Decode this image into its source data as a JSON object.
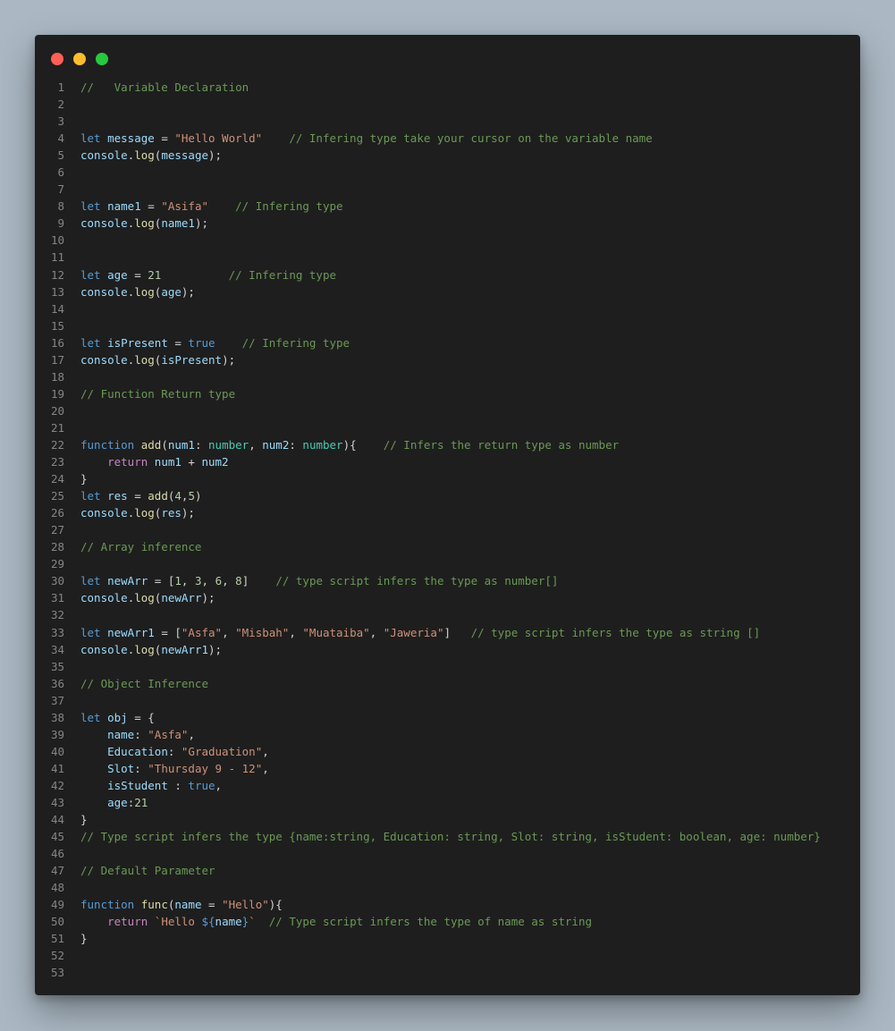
{
  "window": {
    "controls": [
      {
        "name": "close",
        "color": "#ff5f56"
      },
      {
        "name": "minimize",
        "color": "#ffbd2e"
      },
      {
        "name": "maximize",
        "color": "#27c93f"
      }
    ]
  },
  "code_lines": [
    [
      [
        "c",
        "//   Variable Declaration"
      ]
    ],
    [],
    [],
    [
      [
        "k",
        "let"
      ],
      [
        "p",
        " "
      ],
      [
        "v",
        "message"
      ],
      [
        "p",
        " = "
      ],
      [
        "s",
        "\"Hello World\""
      ],
      [
        "p",
        "    "
      ],
      [
        "c",
        "// Infering type take your cursor on the variable name"
      ]
    ],
    [
      [
        "v",
        "console"
      ],
      [
        "p",
        "."
      ],
      [
        "f",
        "log"
      ],
      [
        "p",
        "("
      ],
      [
        "v",
        "message"
      ],
      [
        "p",
        ");"
      ]
    ],
    [],
    [],
    [
      [
        "k",
        "let"
      ],
      [
        "p",
        " "
      ],
      [
        "v",
        "name1"
      ],
      [
        "p",
        " = "
      ],
      [
        "s",
        "\"Asifa\""
      ],
      [
        "p",
        "    "
      ],
      [
        "c",
        "// Infering type"
      ]
    ],
    [
      [
        "v",
        "console"
      ],
      [
        "p",
        "."
      ],
      [
        "f",
        "log"
      ],
      [
        "p",
        "("
      ],
      [
        "v",
        "name1"
      ],
      [
        "p",
        ");"
      ]
    ],
    [],
    [],
    [
      [
        "k",
        "let"
      ],
      [
        "p",
        " "
      ],
      [
        "v",
        "age"
      ],
      [
        "p",
        " = "
      ],
      [
        "n",
        "21"
      ],
      [
        "p",
        "          "
      ],
      [
        "c",
        "// Infering type"
      ]
    ],
    [
      [
        "v",
        "console"
      ],
      [
        "p",
        "."
      ],
      [
        "f",
        "log"
      ],
      [
        "p",
        "("
      ],
      [
        "v",
        "age"
      ],
      [
        "p",
        ");"
      ]
    ],
    [],
    [],
    [
      [
        "k",
        "let"
      ],
      [
        "p",
        " "
      ],
      [
        "v",
        "isPresent"
      ],
      [
        "p",
        " = "
      ],
      [
        "k",
        "true"
      ],
      [
        "p",
        "    "
      ],
      [
        "c",
        "// Infering type"
      ]
    ],
    [
      [
        "v",
        "console"
      ],
      [
        "p",
        "."
      ],
      [
        "f",
        "log"
      ],
      [
        "p",
        "("
      ],
      [
        "v",
        "isPresent"
      ],
      [
        "p",
        ");"
      ]
    ],
    [],
    [
      [
        "c",
        "// Function Return type"
      ]
    ],
    [],
    [],
    [
      [
        "k",
        "function"
      ],
      [
        "p",
        " "
      ],
      [
        "f",
        "add"
      ],
      [
        "p",
        "("
      ],
      [
        "v",
        "num1"
      ],
      [
        "p",
        ": "
      ],
      [
        "t",
        "number"
      ],
      [
        "p",
        ", "
      ],
      [
        "v",
        "num2"
      ],
      [
        "p",
        ": "
      ],
      [
        "t",
        "number"
      ],
      [
        "p",
        "){    "
      ],
      [
        "c",
        "// Infers the return type as number"
      ]
    ],
    [
      [
        "p",
        "    "
      ],
      [
        "r",
        "return"
      ],
      [
        "p",
        " "
      ],
      [
        "v",
        "num1"
      ],
      [
        "p",
        " + "
      ],
      [
        "v",
        "num2"
      ]
    ],
    [
      [
        "p",
        "}"
      ]
    ],
    [
      [
        "k",
        "let"
      ],
      [
        "p",
        " "
      ],
      [
        "v",
        "res"
      ],
      [
        "p",
        " = "
      ],
      [
        "f",
        "add"
      ],
      [
        "p",
        "("
      ],
      [
        "n",
        "4"
      ],
      [
        "p",
        ","
      ],
      [
        "n",
        "5"
      ],
      [
        "p",
        ")"
      ]
    ],
    [
      [
        "v",
        "console"
      ],
      [
        "p",
        "."
      ],
      [
        "f",
        "log"
      ],
      [
        "p",
        "("
      ],
      [
        "v",
        "res"
      ],
      [
        "p",
        ");"
      ]
    ],
    [],
    [
      [
        "c",
        "// Array inference"
      ]
    ],
    [],
    [
      [
        "k",
        "let"
      ],
      [
        "p",
        " "
      ],
      [
        "v",
        "newArr"
      ],
      [
        "p",
        " = ["
      ],
      [
        "n",
        "1"
      ],
      [
        "p",
        ", "
      ],
      [
        "n",
        "3"
      ],
      [
        "p",
        ", "
      ],
      [
        "n",
        "6"
      ],
      [
        "p",
        ", "
      ],
      [
        "n",
        "8"
      ],
      [
        "p",
        "]    "
      ],
      [
        "c",
        "// type script infers the type as number[]"
      ]
    ],
    [
      [
        "v",
        "console"
      ],
      [
        "p",
        "."
      ],
      [
        "f",
        "log"
      ],
      [
        "p",
        "("
      ],
      [
        "v",
        "newArr"
      ],
      [
        "p",
        ");"
      ]
    ],
    [],
    [
      [
        "k",
        "let"
      ],
      [
        "p",
        " "
      ],
      [
        "v",
        "newArr1"
      ],
      [
        "p",
        " = ["
      ],
      [
        "s",
        "\"Asfa\""
      ],
      [
        "p",
        ", "
      ],
      [
        "s",
        "\"Misbah\""
      ],
      [
        "p",
        ", "
      ],
      [
        "s",
        "\"Muataiba\""
      ],
      [
        "p",
        ", "
      ],
      [
        "s",
        "\"Jaweria\""
      ],
      [
        "p",
        "]   "
      ],
      [
        "c",
        "// type script infers the type as string []"
      ]
    ],
    [
      [
        "v",
        "console"
      ],
      [
        "p",
        "."
      ],
      [
        "f",
        "log"
      ],
      [
        "p",
        "("
      ],
      [
        "v",
        "newArr1"
      ],
      [
        "p",
        ");"
      ]
    ],
    [],
    [
      [
        "c",
        "// Object Inference"
      ]
    ],
    [],
    [
      [
        "k",
        "let"
      ],
      [
        "p",
        " "
      ],
      [
        "v",
        "obj"
      ],
      [
        "p",
        " = {"
      ]
    ],
    [
      [
        "p",
        "    "
      ],
      [
        "v",
        "name"
      ],
      [
        "p",
        ": "
      ],
      [
        "s",
        "\"Asfa\""
      ],
      [
        "p",
        ","
      ]
    ],
    [
      [
        "p",
        "    "
      ],
      [
        "v",
        "Education"
      ],
      [
        "p",
        ": "
      ],
      [
        "s",
        "\"Graduation\""
      ],
      [
        "p",
        ","
      ]
    ],
    [
      [
        "p",
        "    "
      ],
      [
        "v",
        "Slot"
      ],
      [
        "p",
        ": "
      ],
      [
        "s",
        "\"Thursday 9 - 12\""
      ],
      [
        "p",
        ","
      ]
    ],
    [
      [
        "p",
        "    "
      ],
      [
        "v",
        "isStudent"
      ],
      [
        "p",
        " : "
      ],
      [
        "k",
        "true"
      ],
      [
        "p",
        ","
      ]
    ],
    [
      [
        "p",
        "    "
      ],
      [
        "v",
        "age"
      ],
      [
        "p",
        ":"
      ],
      [
        "n",
        "21"
      ]
    ],
    [
      [
        "p",
        "}"
      ]
    ],
    [
      [
        "c",
        "// Type script infers the type {name:string, Education: string, Slot: string, isStudent: boolean, age: number}"
      ]
    ],
    [],
    [
      [
        "c",
        "// Default Parameter"
      ]
    ],
    [],
    [
      [
        "k",
        "function"
      ],
      [
        "p",
        " "
      ],
      [
        "f",
        "func"
      ],
      [
        "p",
        "("
      ],
      [
        "v",
        "name"
      ],
      [
        "p",
        " = "
      ],
      [
        "s",
        "\"Hello\""
      ],
      [
        "p",
        "){"
      ]
    ],
    [
      [
        "p",
        "    "
      ],
      [
        "r",
        "return"
      ],
      [
        "p",
        " "
      ],
      [
        "s",
        "`Hello "
      ],
      [
        "k",
        "${"
      ],
      [
        "v",
        "name"
      ],
      [
        "k",
        "}"
      ],
      [
        "s",
        "`"
      ],
      [
        "p",
        "  "
      ],
      [
        "c",
        "// Type script infers the type of name as string"
      ]
    ],
    [
      [
        "p",
        "}"
      ]
    ],
    [],
    []
  ]
}
